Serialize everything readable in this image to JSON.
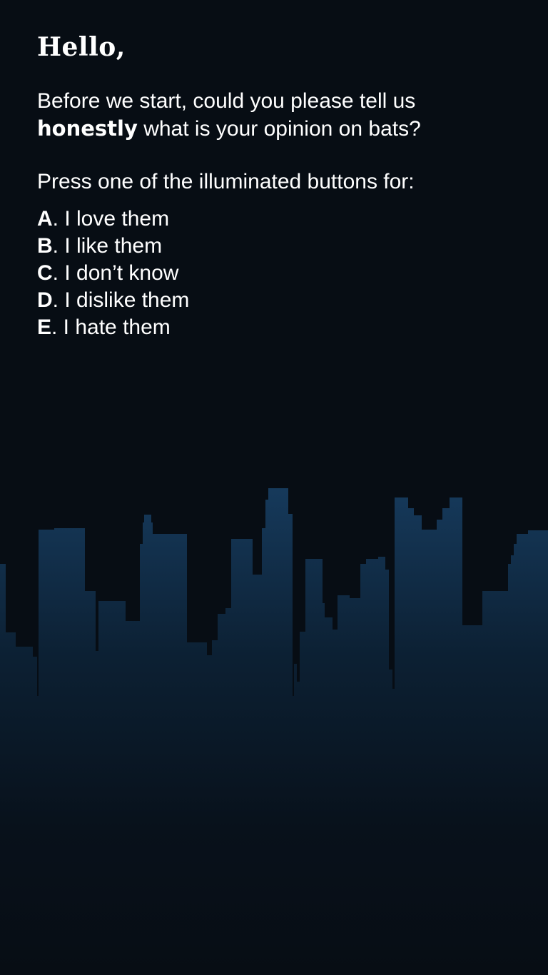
{
  "greeting": "Hello,",
  "intro": {
    "before": "Before we start, could you please tell us",
    "emphasis": "honestly",
    "after": " what is your opinion on bats?"
  },
  "instruction": "Press one of the illuminated buttons for:",
  "options": [
    {
      "letter": "A",
      "text": ". I love them"
    },
    {
      "letter": "B",
      "text": ". I like them"
    },
    {
      "letter": "C",
      "text": ". I don’t know"
    },
    {
      "letter": "D",
      "text": ". I dislike them"
    },
    {
      "letter": "E",
      "text": ". I hate them"
    }
  ],
  "colors": {
    "background": "#070d14",
    "skyline_top": "#163a5c",
    "skyline_bottom": "#070d14",
    "text": "#ffffff"
  }
}
